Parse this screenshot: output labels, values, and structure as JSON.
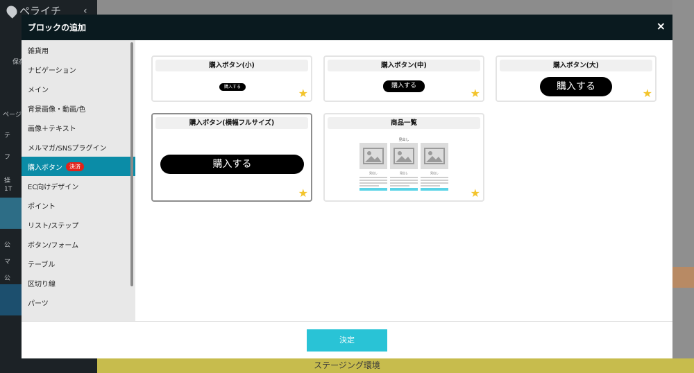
{
  "background": {
    "logo": "ペライチ",
    "collapse": "‹",
    "save": "保存",
    "page": "ページ",
    "text1": "テ",
    "text2": "フ",
    "operation_1": "操",
    "operation_2": "1⁠T",
    "public_items": [
      "公",
      "マ",
      "公"
    ],
    "staging": "ステージング環境"
  },
  "modal": {
    "title": "ブロックの追加",
    "close": "×",
    "categories": [
      {
        "label": "雑貨用"
      },
      {
        "label": "ナビゲーション"
      },
      {
        "label": "メイン"
      },
      {
        "label": "背景画像・動画/色"
      },
      {
        "label": "画像＋テキスト"
      },
      {
        "label": "メルマガ/SNSプラグイン"
      },
      {
        "label": "購入ボタン",
        "badge": "決済",
        "active": true
      },
      {
        "label": "EC向けデザイン"
      },
      {
        "label": "ポイント"
      },
      {
        "label": "リスト/ステップ"
      },
      {
        "label": "ボタン/フォーム"
      },
      {
        "label": "テーブル"
      },
      {
        "label": "区切り線"
      },
      {
        "label": "パーツ"
      }
    ],
    "cards": [
      {
        "title": "購入ボタン(小)",
        "button": "購入する"
      },
      {
        "title": "購入ボタン(中)",
        "button": "購入する"
      },
      {
        "title": "購入ボタン(大)",
        "button": "購入する"
      },
      {
        "title": "購入ボタン(横幅フルサイズ)",
        "button": "購入する"
      },
      {
        "title": "商品一覧",
        "heading": "見出し",
        "item_name": "見出し"
      }
    ],
    "star": "★",
    "decide": "決定"
  }
}
